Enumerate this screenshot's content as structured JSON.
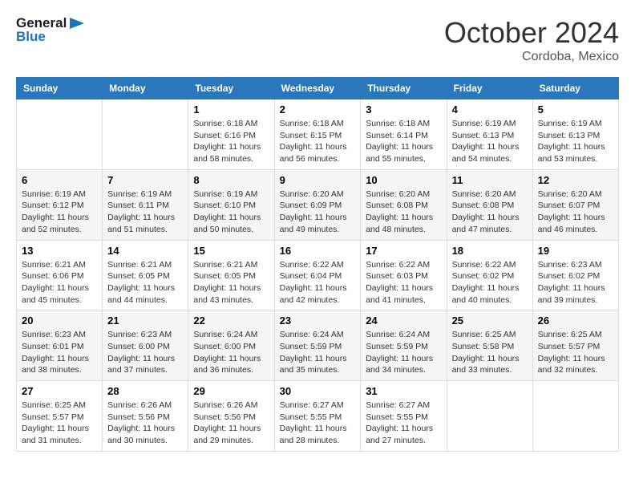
{
  "header": {
    "logo_line1": "General",
    "logo_line2": "Blue",
    "month": "October 2024",
    "location": "Cordoba, Mexico"
  },
  "weekdays": [
    "Sunday",
    "Monday",
    "Tuesday",
    "Wednesday",
    "Thursday",
    "Friday",
    "Saturday"
  ],
  "weeks": [
    [
      {
        "day": "",
        "info": ""
      },
      {
        "day": "",
        "info": ""
      },
      {
        "day": "1",
        "info": "Sunrise: 6:18 AM\nSunset: 6:16 PM\nDaylight: 11 hours and 58 minutes."
      },
      {
        "day": "2",
        "info": "Sunrise: 6:18 AM\nSunset: 6:15 PM\nDaylight: 11 hours and 56 minutes."
      },
      {
        "day": "3",
        "info": "Sunrise: 6:18 AM\nSunset: 6:14 PM\nDaylight: 11 hours and 55 minutes."
      },
      {
        "day": "4",
        "info": "Sunrise: 6:19 AM\nSunset: 6:13 PM\nDaylight: 11 hours and 54 minutes."
      },
      {
        "day": "5",
        "info": "Sunrise: 6:19 AM\nSunset: 6:13 PM\nDaylight: 11 hours and 53 minutes."
      }
    ],
    [
      {
        "day": "6",
        "info": "Sunrise: 6:19 AM\nSunset: 6:12 PM\nDaylight: 11 hours and 52 minutes."
      },
      {
        "day": "7",
        "info": "Sunrise: 6:19 AM\nSunset: 6:11 PM\nDaylight: 11 hours and 51 minutes."
      },
      {
        "day": "8",
        "info": "Sunrise: 6:19 AM\nSunset: 6:10 PM\nDaylight: 11 hours and 50 minutes."
      },
      {
        "day": "9",
        "info": "Sunrise: 6:20 AM\nSunset: 6:09 PM\nDaylight: 11 hours and 49 minutes."
      },
      {
        "day": "10",
        "info": "Sunrise: 6:20 AM\nSunset: 6:08 PM\nDaylight: 11 hours and 48 minutes."
      },
      {
        "day": "11",
        "info": "Sunrise: 6:20 AM\nSunset: 6:08 PM\nDaylight: 11 hours and 47 minutes."
      },
      {
        "day": "12",
        "info": "Sunrise: 6:20 AM\nSunset: 6:07 PM\nDaylight: 11 hours and 46 minutes."
      }
    ],
    [
      {
        "day": "13",
        "info": "Sunrise: 6:21 AM\nSunset: 6:06 PM\nDaylight: 11 hours and 45 minutes."
      },
      {
        "day": "14",
        "info": "Sunrise: 6:21 AM\nSunset: 6:05 PM\nDaylight: 11 hours and 44 minutes."
      },
      {
        "day": "15",
        "info": "Sunrise: 6:21 AM\nSunset: 6:05 PM\nDaylight: 11 hours and 43 minutes."
      },
      {
        "day": "16",
        "info": "Sunrise: 6:22 AM\nSunset: 6:04 PM\nDaylight: 11 hours and 42 minutes."
      },
      {
        "day": "17",
        "info": "Sunrise: 6:22 AM\nSunset: 6:03 PM\nDaylight: 11 hours and 41 minutes."
      },
      {
        "day": "18",
        "info": "Sunrise: 6:22 AM\nSunset: 6:02 PM\nDaylight: 11 hours and 40 minutes."
      },
      {
        "day": "19",
        "info": "Sunrise: 6:23 AM\nSunset: 6:02 PM\nDaylight: 11 hours and 39 minutes."
      }
    ],
    [
      {
        "day": "20",
        "info": "Sunrise: 6:23 AM\nSunset: 6:01 PM\nDaylight: 11 hours and 38 minutes."
      },
      {
        "day": "21",
        "info": "Sunrise: 6:23 AM\nSunset: 6:00 PM\nDaylight: 11 hours and 37 minutes."
      },
      {
        "day": "22",
        "info": "Sunrise: 6:24 AM\nSunset: 6:00 PM\nDaylight: 11 hours and 36 minutes."
      },
      {
        "day": "23",
        "info": "Sunrise: 6:24 AM\nSunset: 5:59 PM\nDaylight: 11 hours and 35 minutes."
      },
      {
        "day": "24",
        "info": "Sunrise: 6:24 AM\nSunset: 5:59 PM\nDaylight: 11 hours and 34 minutes."
      },
      {
        "day": "25",
        "info": "Sunrise: 6:25 AM\nSunset: 5:58 PM\nDaylight: 11 hours and 33 minutes."
      },
      {
        "day": "26",
        "info": "Sunrise: 6:25 AM\nSunset: 5:57 PM\nDaylight: 11 hours and 32 minutes."
      }
    ],
    [
      {
        "day": "27",
        "info": "Sunrise: 6:25 AM\nSunset: 5:57 PM\nDaylight: 11 hours and 31 minutes."
      },
      {
        "day": "28",
        "info": "Sunrise: 6:26 AM\nSunset: 5:56 PM\nDaylight: 11 hours and 30 minutes."
      },
      {
        "day": "29",
        "info": "Sunrise: 6:26 AM\nSunset: 5:56 PM\nDaylight: 11 hours and 29 minutes."
      },
      {
        "day": "30",
        "info": "Sunrise: 6:27 AM\nSunset: 5:55 PM\nDaylight: 11 hours and 28 minutes."
      },
      {
        "day": "31",
        "info": "Sunrise: 6:27 AM\nSunset: 5:55 PM\nDaylight: 11 hours and 27 minutes."
      },
      {
        "day": "",
        "info": ""
      },
      {
        "day": "",
        "info": ""
      }
    ]
  ]
}
